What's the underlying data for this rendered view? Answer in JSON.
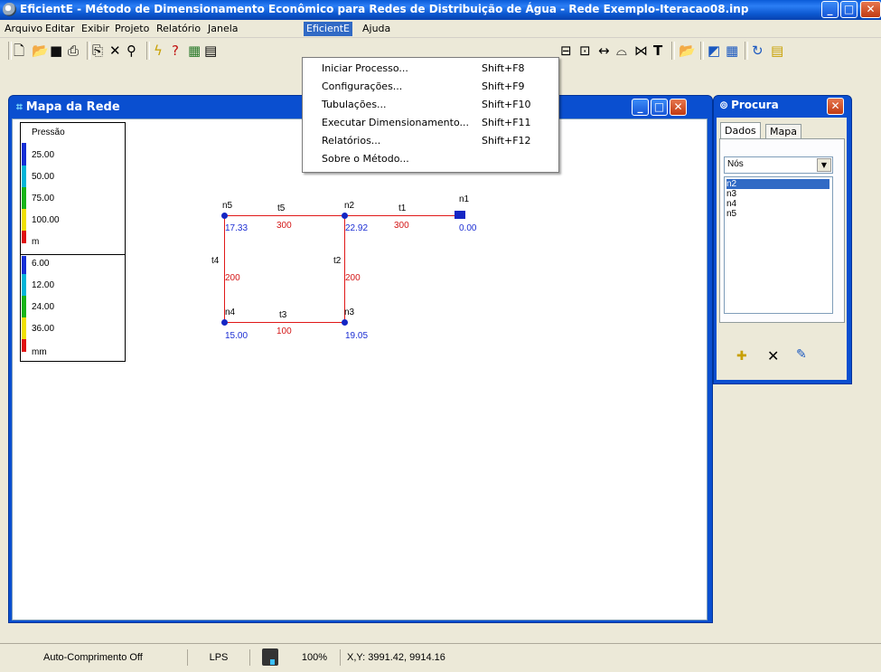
{
  "window": {
    "title": "EficientE - Método de Dimensionamento Econômico para Redes de Distribuição de Água - Rede Exemplo-Iteracao08.inp"
  },
  "menubar": [
    "Arquivo",
    "Editar",
    "Exibir",
    "Projeto",
    "Relatório",
    "Janela",
    "EficientE",
    "Ajuda"
  ],
  "menu_active": "EficientE",
  "dropdown": [
    {
      "label": "Iniciar Processo...",
      "shortcut": "Shift+F8"
    },
    {
      "label": "Configurações...",
      "shortcut": "Shift+F9"
    },
    {
      "label": "Tubulações...",
      "shortcut": "Shift+F10"
    },
    {
      "label": "Executar Dimensionamento...",
      "shortcut": "Shift+F11"
    },
    {
      "label": "Relatórios...",
      "shortcut": "Shift+F12"
    },
    {
      "label": "Sobre o Método...",
      "shortcut": ""
    }
  ],
  "map_window": {
    "title": "Mapa da Rede"
  },
  "legend": {
    "pressure": {
      "title": "Pressão",
      "values": [
        "25.00",
        "50.00",
        "75.00",
        "100.00"
      ],
      "unit": "m"
    },
    "diameter": {
      "values": [
        "6.00",
        "12.00",
        "24.00",
        "36.00"
      ],
      "unit": "mm"
    },
    "colors": [
      "#1530d6",
      "#00b4d8",
      "#18b418",
      "#f0e000",
      "#e01010"
    ]
  },
  "network": {
    "nodes": [
      {
        "id": "n5",
        "value": "17.33"
      },
      {
        "id": "n2",
        "value": "22.92"
      },
      {
        "id": "n1",
        "value": "0.00"
      },
      {
        "id": "n4",
        "value": "15.00"
      },
      {
        "id": "n3",
        "value": "19.05"
      }
    ],
    "pipes": [
      {
        "id": "t5",
        "value": "300"
      },
      {
        "id": "t1",
        "value": "300"
      },
      {
        "id": "t4",
        "value": "200"
      },
      {
        "id": "t2",
        "value": "200"
      },
      {
        "id": "t3",
        "value": "100"
      }
    ]
  },
  "procura": {
    "title": "Procura",
    "tabs": [
      "Dados",
      "Mapa"
    ],
    "select_value": "Nós",
    "items": [
      "n2",
      "n3",
      "n4",
      "n5"
    ],
    "selected": "n2"
  },
  "statusbar": {
    "auto_length": "Auto-Comprimento Off",
    "units": "LPS",
    "zoom": "100%",
    "coords": "X,Y: 3991.42, 9914.16"
  }
}
